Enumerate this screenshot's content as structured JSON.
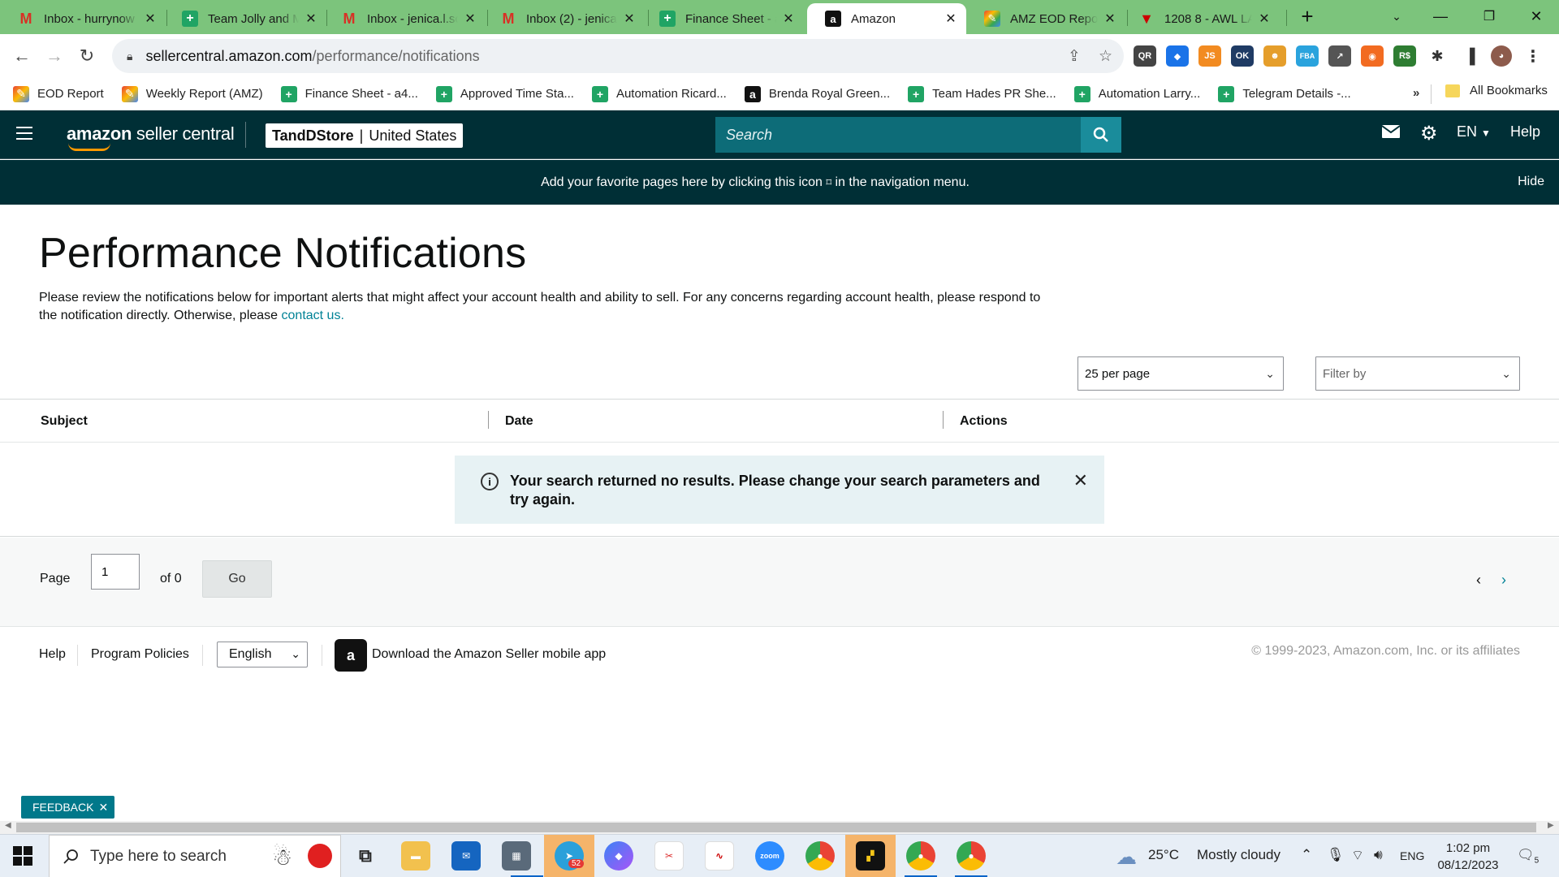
{
  "browser": {
    "tabs": [
      {
        "title": "Inbox - hurrynow",
        "icon": "gmail-icon"
      },
      {
        "title": "Team Jolly and M",
        "icon": "sheets-icon"
      },
      {
        "title": "Inbox - jenica.l.sc",
        "icon": "gmail-icon"
      },
      {
        "title": "Inbox (2) - jenica",
        "icon": "gmail-icon"
      },
      {
        "title": "Finance Sheet - a",
        "icon": "sheets-icon"
      },
      {
        "title": "Amazon",
        "icon": "amazon-icon"
      },
      {
        "title": "AMZ EOD Repor",
        "icon": "multicolor-icon"
      },
      {
        "title": "1208 8 - AWL LA",
        "icon": "red-v-icon"
      }
    ],
    "url_host": "sellercentral.amazon.com",
    "url_path": "/performance/notifications",
    "bookmarks": [
      {
        "label": "EOD Report"
      },
      {
        "label": "Weekly Report (AMZ)"
      },
      {
        "label": "Finance Sheet - a4..."
      },
      {
        "label": "Approved Time Sta..."
      },
      {
        "label": "Automation Ricard..."
      },
      {
        "label": "Brenda Royal Green..."
      },
      {
        "label": "Team Hades PR She..."
      },
      {
        "label": "Automation Larry..."
      },
      {
        "label": "Telegram Details -..."
      }
    ],
    "bookmarks_more": "»",
    "all_bookmarks": "All Bookmarks",
    "extensions": [
      {
        "label": "QR",
        "color": "#444444"
      },
      {
        "label": "◆",
        "color": "#1a73e8"
      },
      {
        "label": "JS",
        "color": "#f28b21"
      },
      {
        "label": "OK",
        "color": "#1f3b64"
      },
      {
        "label": "☻",
        "color": "#e59e2b"
      },
      {
        "label": "FBA",
        "color": "#2aa3dd"
      },
      {
        "label": "↗",
        "color": "#555555"
      },
      {
        "label": "◉",
        "color": "#f26b21"
      },
      {
        "label": "R$",
        "color": "#2e7d32"
      }
    ]
  },
  "header": {
    "logo_amazon": "amazon",
    "logo_rest": " seller central",
    "store_name": "TandDStore",
    "store_region": "United States",
    "search_placeholder": "Search",
    "language": "EN",
    "help": "Help"
  },
  "banner": {
    "message_before": "Add your favorite pages here by clicking this icon ",
    "message_after": " in the navigation menu.",
    "hide": "Hide"
  },
  "main": {
    "title": "Performance Notifications",
    "intro": "Please review the notifications below for important alerts that might affect your account health and ability to sell. For any concerns regarding account health, please respond to the notification directly. Otherwise, please ",
    "contact_link": "contact us.",
    "per_page": "25 per page",
    "filter_placeholder": "Filter by",
    "columns": [
      "Subject",
      "Date",
      "Actions"
    ],
    "alert": "Your search returned no results. Please change your search parameters and try again."
  },
  "pager": {
    "page_label": "Page",
    "page_value": "1",
    "of_label": "of 0",
    "go": "Go"
  },
  "footer": {
    "help": "Help",
    "program_policies": "Program Policies",
    "language": "English",
    "download_app": "Download the Amazon Seller mobile app",
    "copyright": "© 1999-2023, Amazon.com, Inc. or its affiliates"
  },
  "feedback": "FEEDBACK",
  "taskbar": {
    "search_placeholder": "Type here to search",
    "weather_temp": "25°C",
    "weather_desc": "Mostly cloudy",
    "lang": "ENG",
    "time": "1:02 pm",
    "date": "08/12/2023",
    "notification_count": "5",
    "telegram_badge": "52"
  }
}
